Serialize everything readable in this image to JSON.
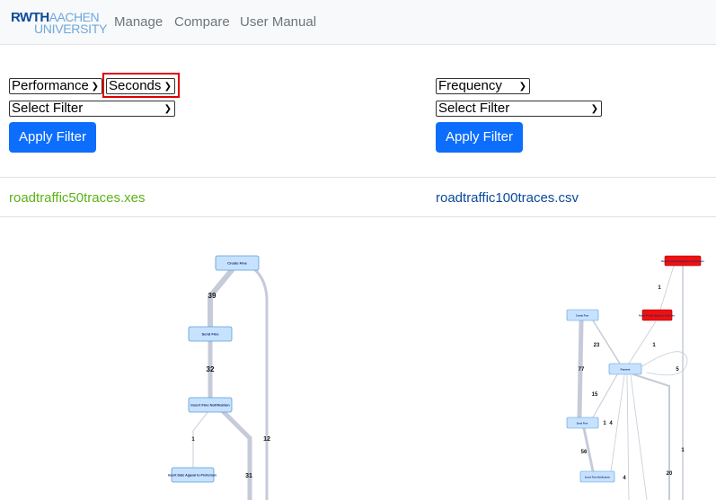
{
  "navbar": {
    "logo_top": "RWTH",
    "logo_top_suffix": "AACHEN",
    "logo_bottom": "UNIVERSITY",
    "links": [
      "Manage",
      "Compare",
      "User Manual"
    ]
  },
  "left": {
    "metric_select": "Performance",
    "unit_select": "Seconds",
    "filter_select": "Select Filter",
    "apply_label": "Apply Filter",
    "file_name": "roadtraffic50traces.xes",
    "file_color": "#5cb317",
    "graph": {
      "nodes": [
        "Create Fine",
        "Send Fine",
        "Insert Fine Notification",
        "Insert Date Appeal to Prefecture"
      ],
      "edge_labels": [
        "39",
        "32",
        "1",
        "12",
        "31"
      ]
    }
  },
  "right": {
    "metric_select": "Frequency",
    "filter_select": "Select Filter",
    "apply_label": "Apply Filter",
    "file_name": "roadtraffic100traces.csv",
    "file_color": "#0a4a9b",
    "graph": {
      "nodes": [
        "Receive Result Appeal from Prefecture",
        "Notify Result Appeal to Offender",
        "Create Fine",
        "Payment",
        "Send Fine",
        "Insert Fine Notification"
      ],
      "edge_labels": [
        "1",
        "23",
        "1",
        "5",
        "77",
        "15",
        "1",
        "4",
        "56",
        "1",
        "4",
        "20"
      ]
    }
  },
  "colors": {
    "accent": "#0d6efd",
    "highlight": "#e00000",
    "node_fill": "#c6e2ff",
    "node_border": "#5b9bd5",
    "node_red": "#ee1111",
    "edge": "#c5cbd8"
  }
}
